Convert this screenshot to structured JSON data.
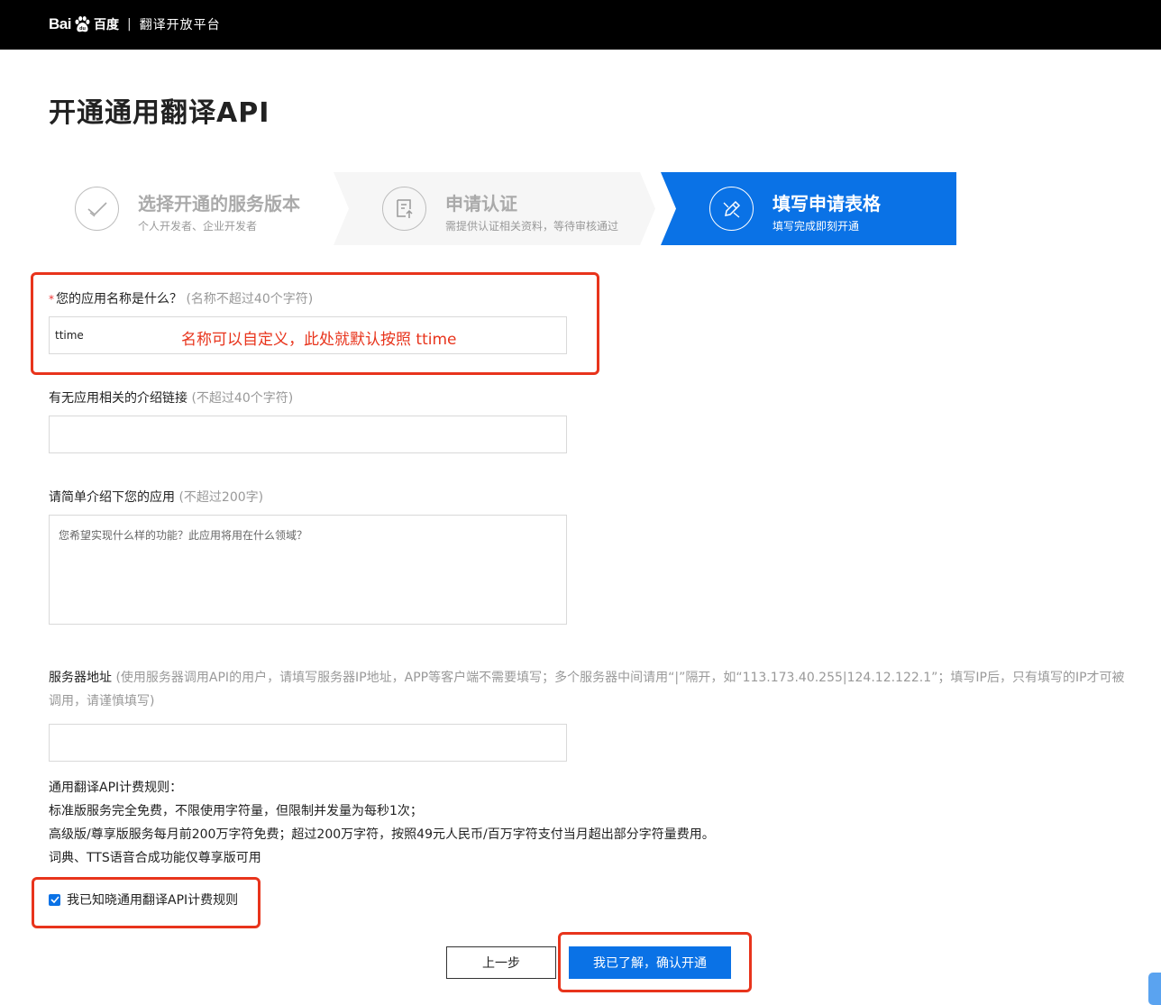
{
  "header": {
    "logo_text": "Bai",
    "logo_text2": "百度",
    "separator": "|",
    "platform_name": "翻译开放平台"
  },
  "page": {
    "title": "开通通用翻译API"
  },
  "steps": [
    {
      "title": "选择开通的服务版本",
      "subtitle": "个人开发者、企业开发者",
      "icon": "check-icon"
    },
    {
      "title": "申请认证",
      "subtitle": "需提供认证相关资料，等待审核通过",
      "icon": "document-upload-icon"
    },
    {
      "title": "填写申请表格",
      "subtitle": "填写完成即刻开通",
      "icon": "pencil-icon",
      "active": true
    }
  ],
  "form": {
    "app_name": {
      "required_mark": "*",
      "label": "您的应用名称是什么？",
      "hint": "(名称不超过40个字符)",
      "value": "ttime",
      "annotation": "名称可以自定义，此处就默认按照 ttime"
    },
    "app_link": {
      "label": "有无应用相关的介绍链接",
      "hint": "(不超过40个字符)",
      "value": ""
    },
    "app_intro": {
      "label": "请简单介绍下您的应用",
      "hint": "(不超过200字)",
      "placeholder": "您希望实现什么样的功能？此应用将用在什么领域？"
    },
    "server_address": {
      "label": "服务器地址",
      "hint": "(使用服务器调用API的用户，请填写服务器IP地址，APP等客户端不需要填写；多个服务器中间请用“|”隔开，如“113.173.40.255|124.12.122.1”；填写IP后，只有填写的IP才可被调用，请谨慎填写)",
      "value": ""
    }
  },
  "billing_rules": {
    "heading": "通用翻译API计费规则：",
    "lines": [
      "标准版服务完全免费，不限使用字符量，但限制并发量为每秒1次；",
      "高级版/尊享版服务每月前200万字符免费；超过200万字符，按照49元人民币/百万字符支付当月超出部分字符量费用。",
      "词典、TTS语音合成功能仅尊享版可用"
    ]
  },
  "agreement": {
    "checked": true,
    "label": "我已知晓通用翻译API计费规则"
  },
  "buttons": {
    "prev": "上一步",
    "confirm": "我已了解，确认开通"
  },
  "colors": {
    "brand_blue": "#0a72e6",
    "annotation_red": "#e8341c",
    "header_bg": "#000000"
  }
}
